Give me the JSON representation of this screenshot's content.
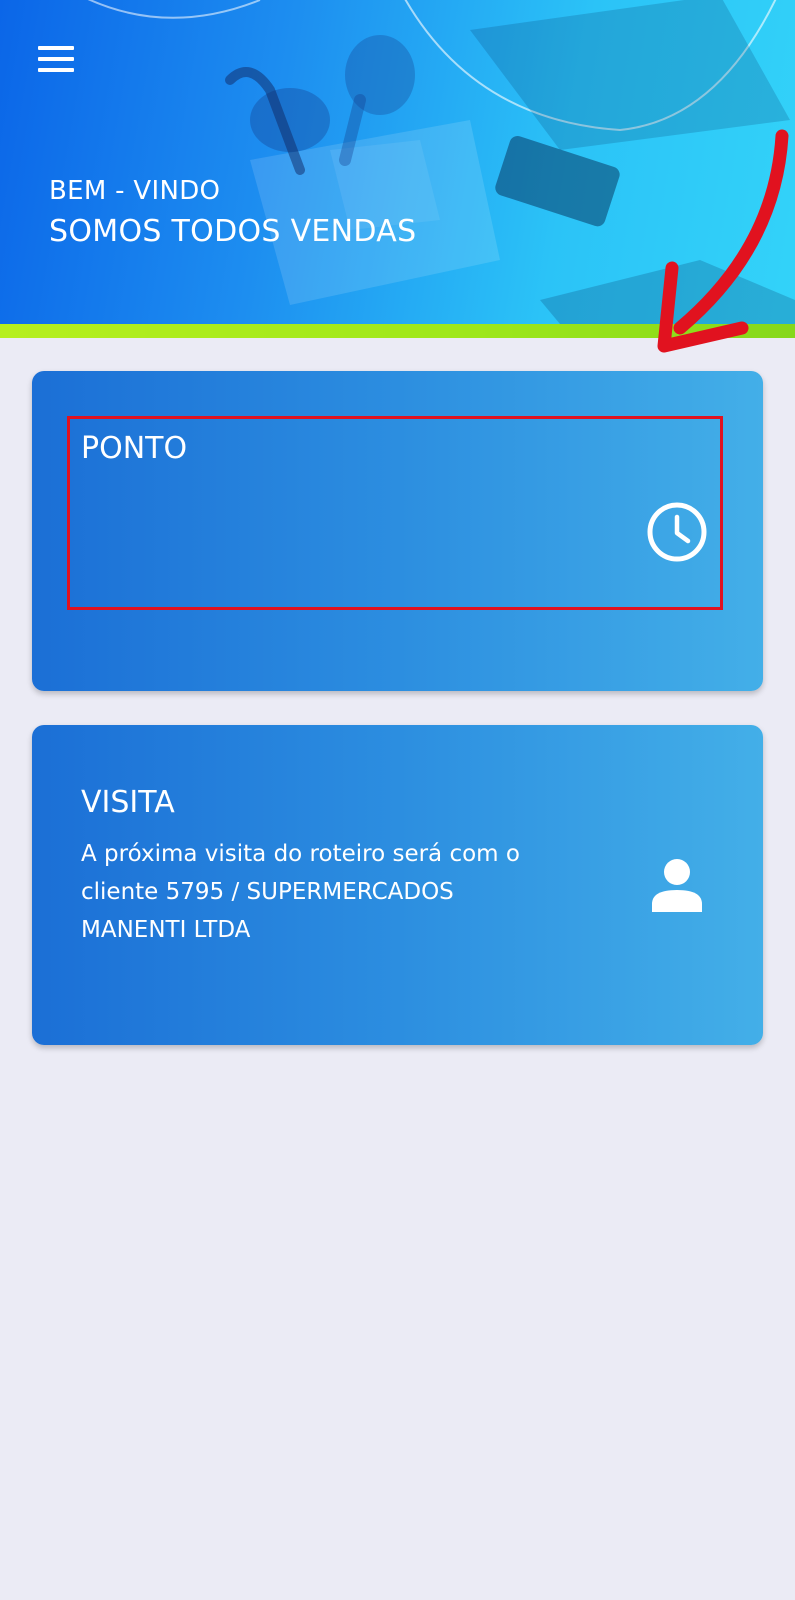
{
  "header": {
    "welcome": "BEM - VINDO",
    "tagline": "SOMOS TODOS VENDAS",
    "menu_icon": "hamburger-menu-icon"
  },
  "cards": {
    "ponto": {
      "title": "PONTO",
      "icon": "clock-icon"
    },
    "visita": {
      "title": "VISITA",
      "description": "A próxima visita do roteiro será com o cliente 5795 / SUPERMERCADOS MANENTI LTDA",
      "icon": "person-icon"
    }
  },
  "annotations": {
    "highlight_color": "#e1121f",
    "arrow_color": "#e1121f"
  },
  "colors": {
    "background": "#ebebf5",
    "card_gradient_start": "#1b6fd6",
    "card_gradient_end": "#43afe8",
    "accent_green": "#9ee71a"
  }
}
